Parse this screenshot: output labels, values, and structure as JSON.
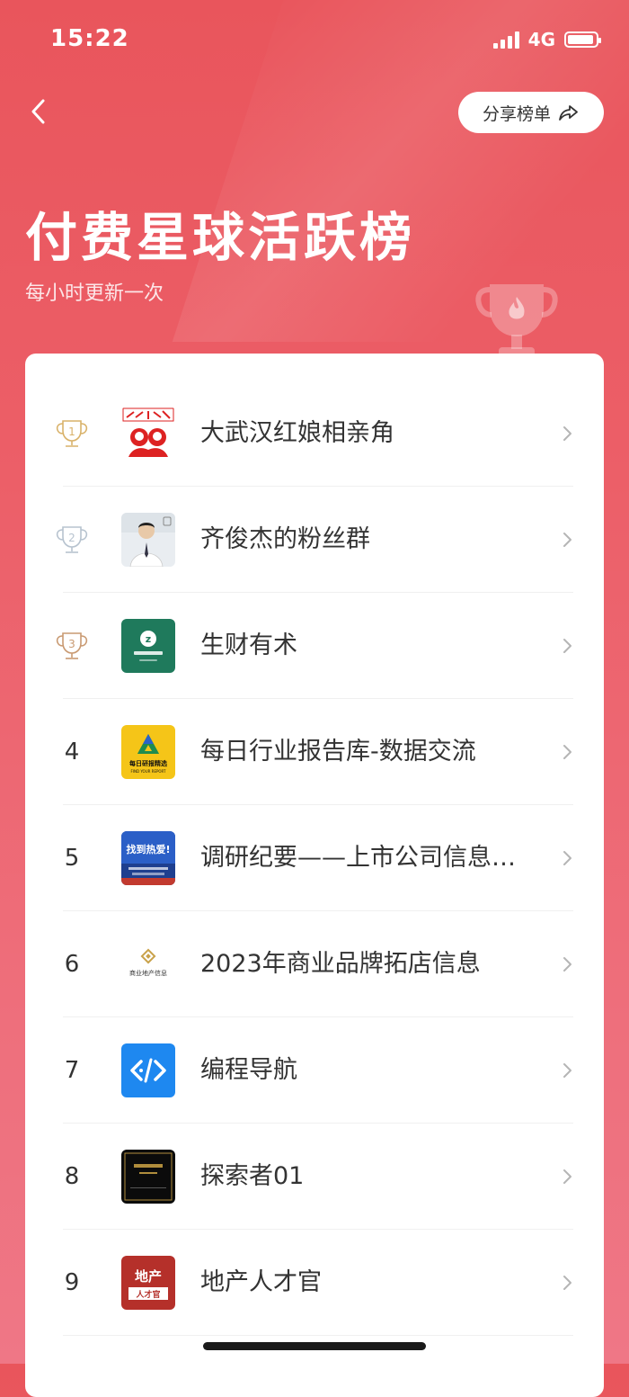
{
  "status_bar": {
    "time": "15:22",
    "network": "4G"
  },
  "header": {
    "share_label": "分享榜单",
    "title": "付费星球活跃榜",
    "subtitle": "每小时更新一次"
  },
  "ranking": [
    {
      "rank": "1",
      "name": "大武汉红娘相亲角"
    },
    {
      "rank": "2",
      "name": "齐俊杰的粉丝群"
    },
    {
      "rank": "3",
      "name": "生财有术"
    },
    {
      "rank": "4",
      "name": "每日行业报告库-数据交流"
    },
    {
      "rank": "5",
      "name": "调研纪要——上市公司信息交流"
    },
    {
      "rank": "6",
      "name": "2023年商业品牌拓店信息"
    },
    {
      "rank": "7",
      "name": "编程导航"
    },
    {
      "rank": "8",
      "name": "探索者01"
    },
    {
      "rank": "9",
      "name": "地产人才官"
    }
  ],
  "avatars": {
    "item_4_text_1": "每日研报精选",
    "item_4_text_2": "FIND YOUR REPORT",
    "item_5_text": "找到热爱!",
    "item_6_text": "商业地产信息",
    "item_9_text_1": "地产",
    "item_9_text_2": "人才官"
  },
  "colors": {
    "accent": "#e9555c",
    "gold": "#d9b26a",
    "silver": "#b7c3cf",
    "bronze": "#c99a72"
  }
}
